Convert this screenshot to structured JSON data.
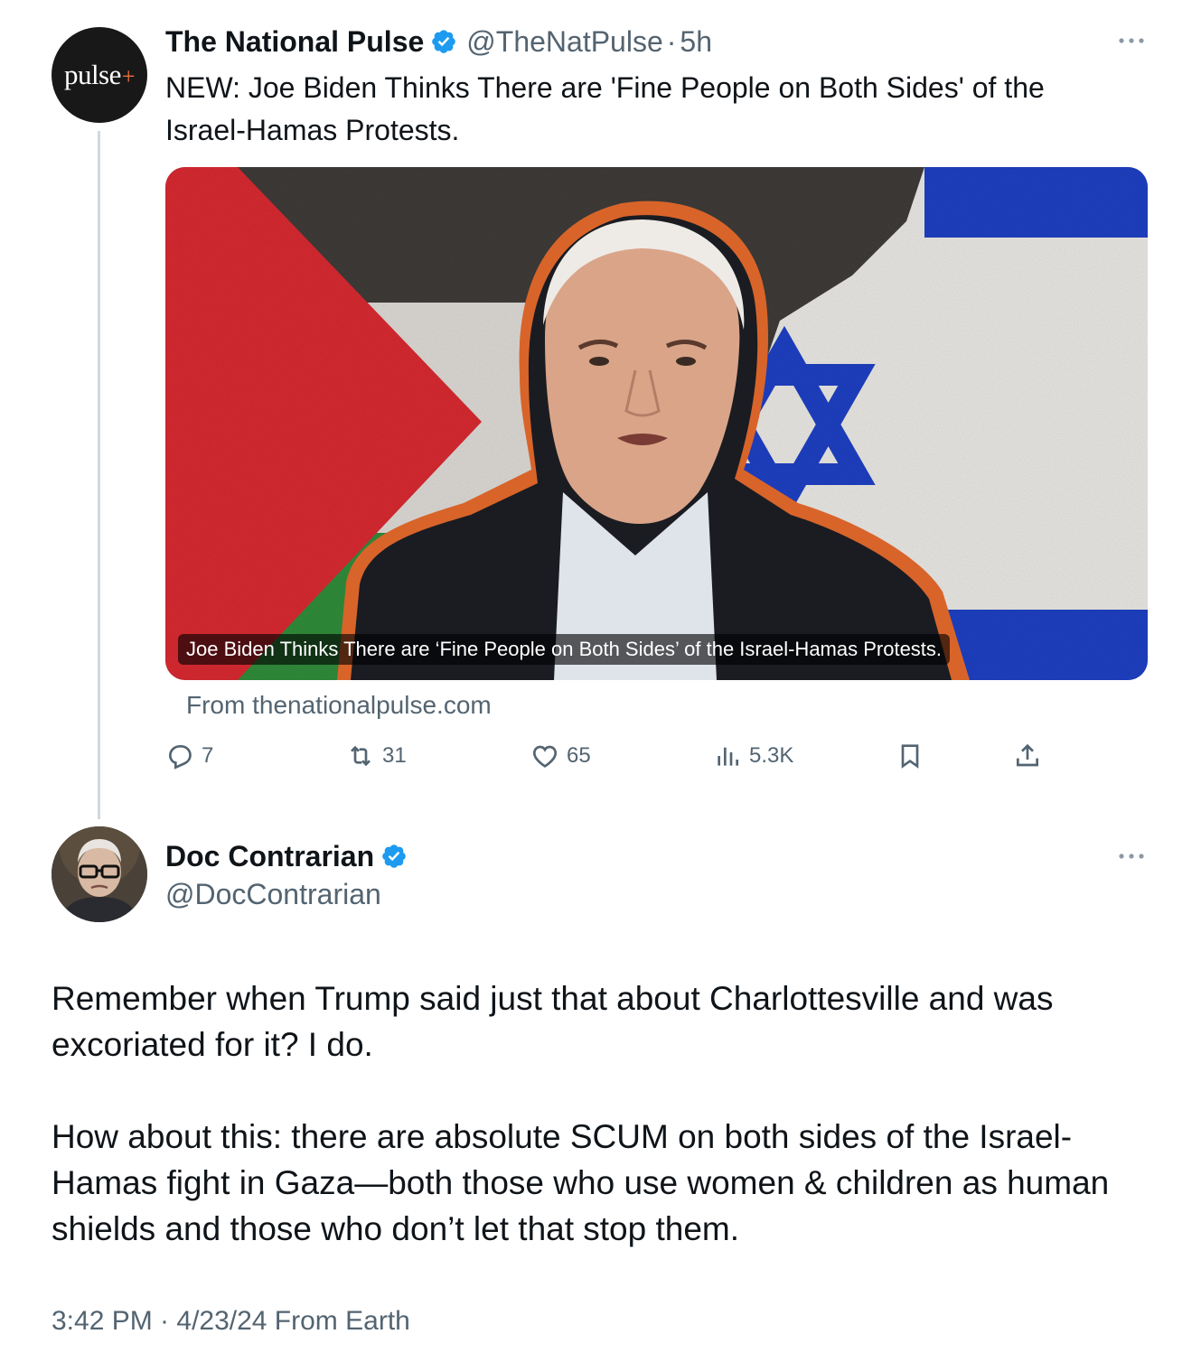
{
  "parent_tweet": {
    "avatar_logo_text": "pulse",
    "avatar_logo_plus": "+",
    "author_name": "The National Pulse",
    "author_handle": "@TheNatPulse",
    "separator": "·",
    "time_ago": "5h",
    "text": "NEW: Joe Biden Thinks There are 'Fine People on Both Sides' of the Israel-Hamas Protests.",
    "card": {
      "caption": "Joe Biden Thinks There are ‘Fine People on Both Sides’ of the Israel-Hamas Protests.",
      "source": "From thenationalpulse.com",
      "image_description_icon": "photo-image"
    },
    "actions": {
      "replies": "7",
      "reposts": "31",
      "likes": "65",
      "views": "5.3K"
    },
    "more_icon": "ellipsis-icon"
  },
  "reply_tweet": {
    "author_name": "Doc Contrarian",
    "author_handle": "@DocContrarian",
    "paragraphs": [
      "Remember when Trump said just that about Charlottesville and was excoriated for it? I do.",
      "How about this: there are absolute SCUM on both sides of the Israel-Hamas fight in Gaza—both those who use women & children as human shields and those who don’t let that stop them."
    ],
    "timestamp": "3:42 PM · 4/23/24 From Earth",
    "more_icon": "ellipsis-icon"
  },
  "colors": {
    "verified_blue": "#1d9bf0",
    "secondary_text": "#536471",
    "thread_line": "#cfd9de",
    "palestine_red": "#d42a31",
    "palestine_green": "#2f8a3a",
    "israel_blue": "#1f3fbf",
    "outline_orange": "#d8642a"
  }
}
